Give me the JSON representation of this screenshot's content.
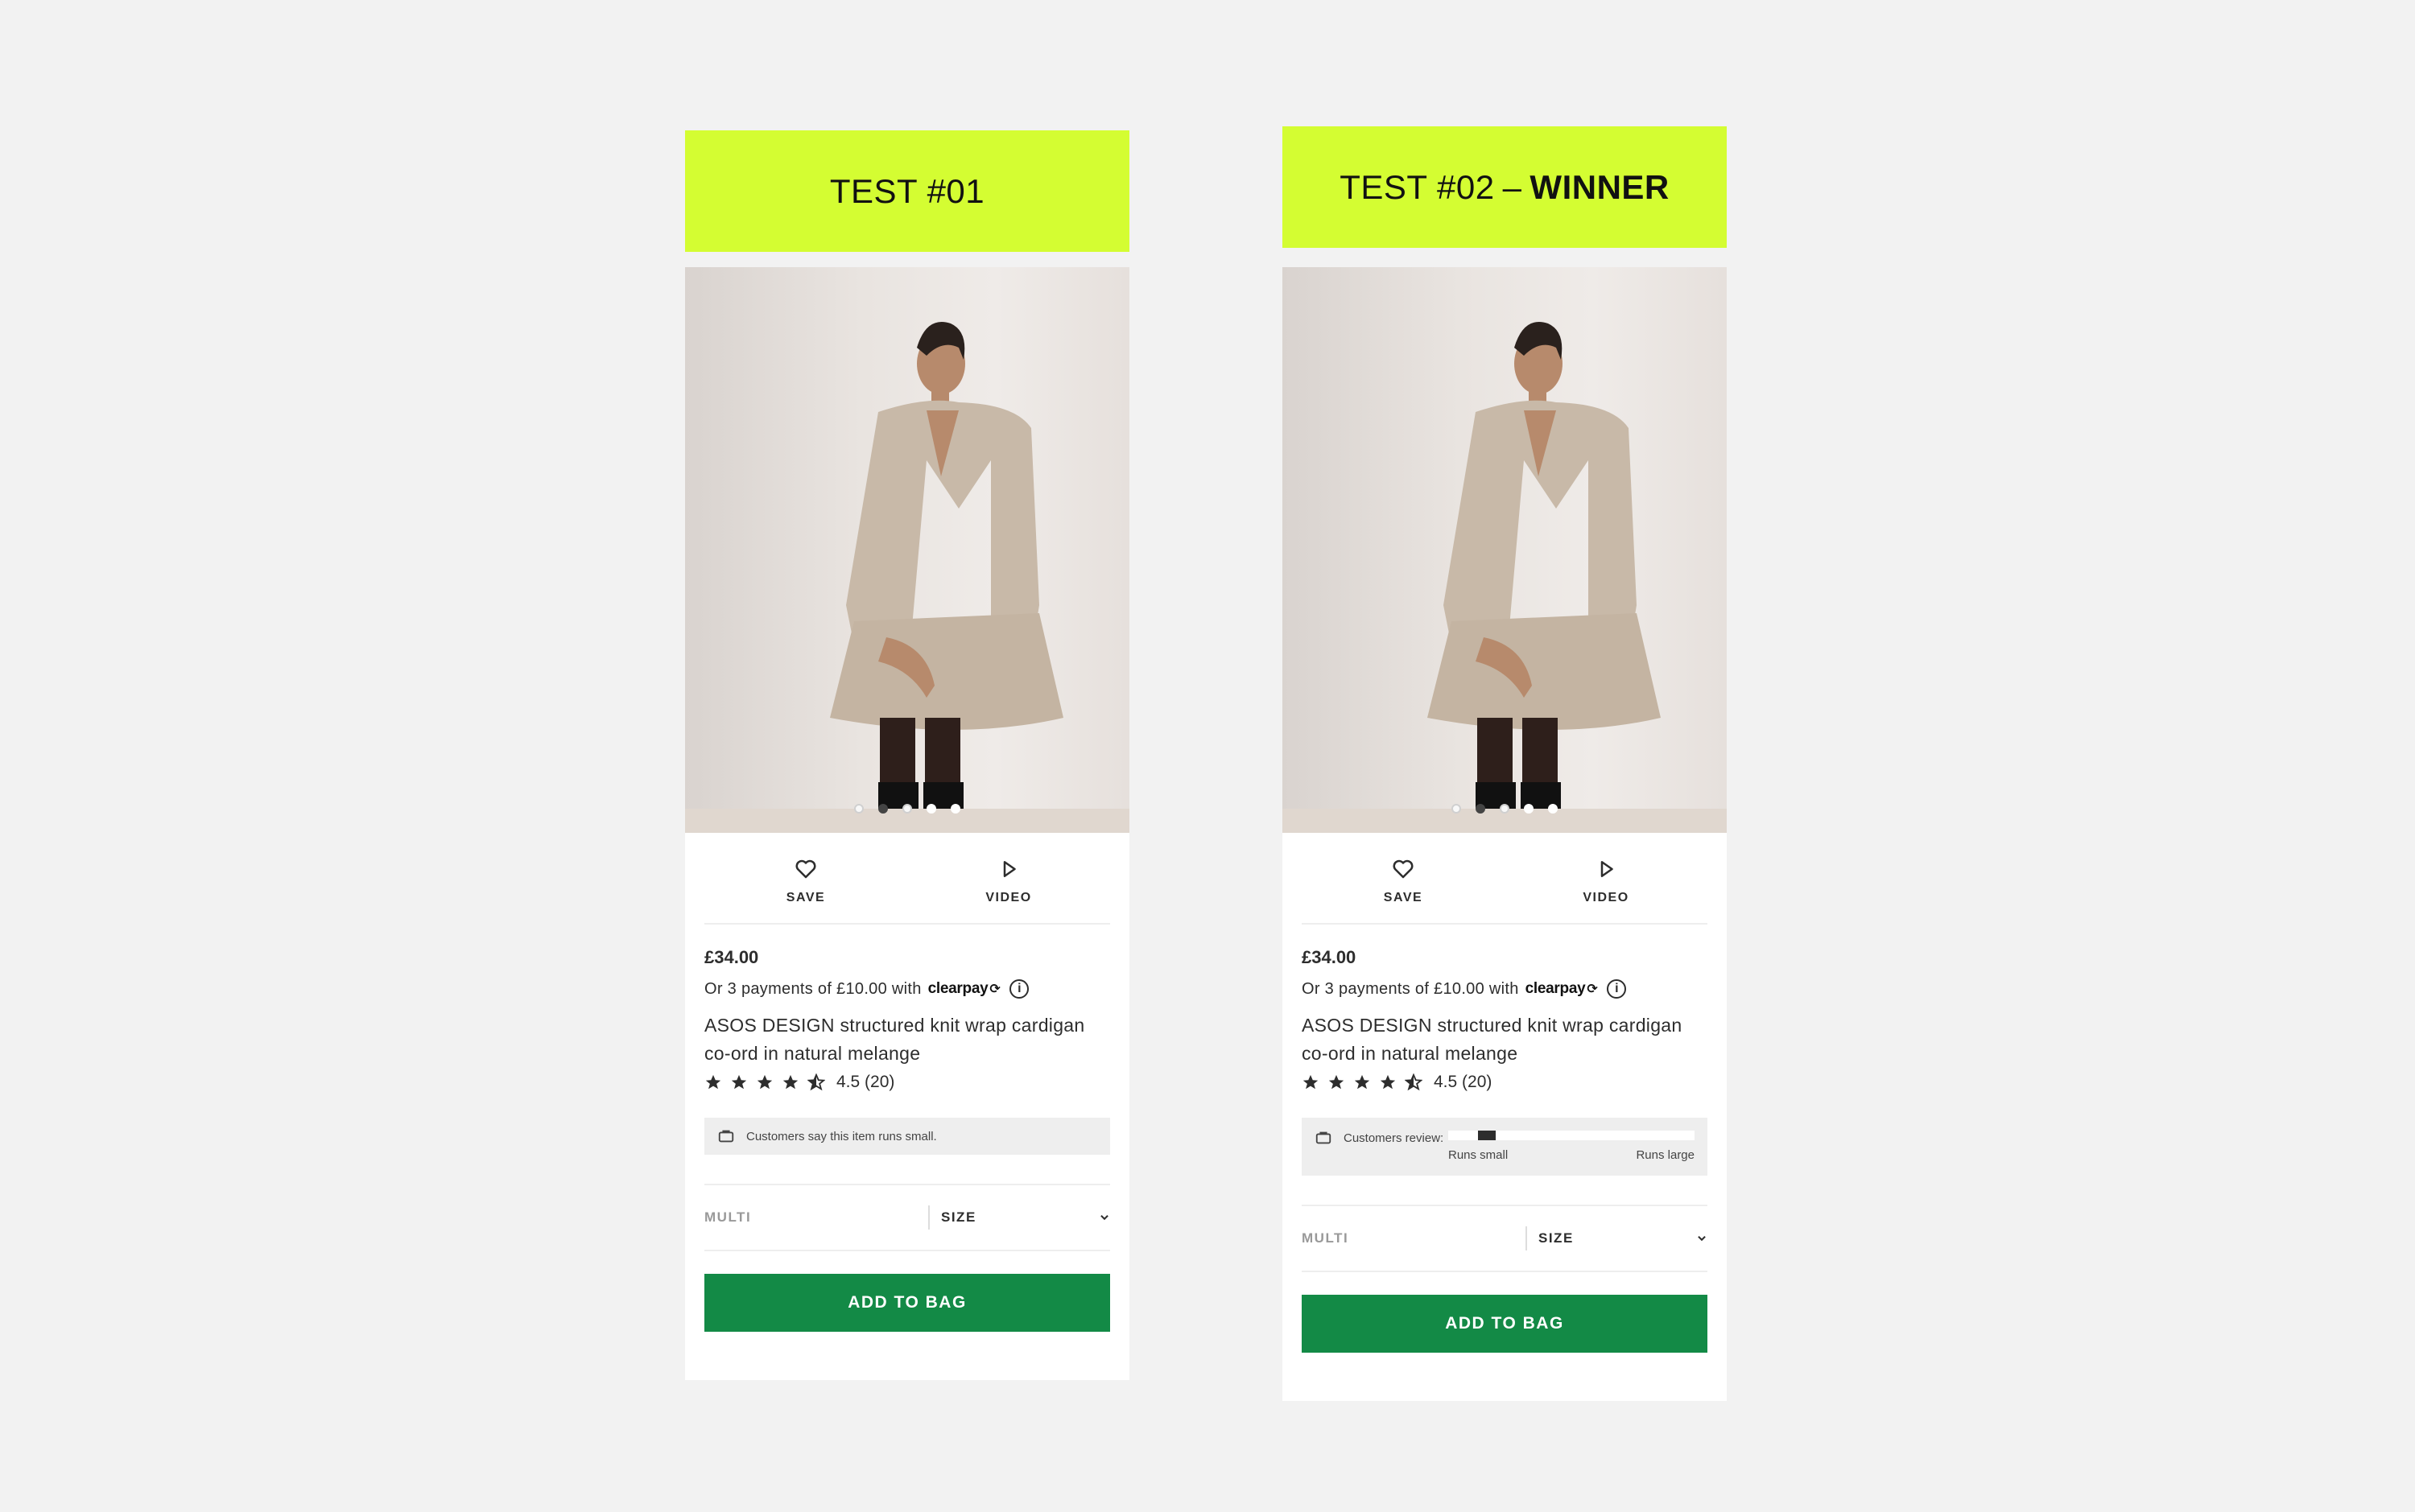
{
  "tests": [
    {
      "header_text": "TEST #01",
      "header_sep": "",
      "header_bold": "",
      "actions": {
        "save": "SAVE",
        "video": "VIDEO"
      },
      "price": "£34.00",
      "installments": "Or 3 payments of £10.00 with",
      "payment_brand": "clearpay",
      "product_title": "ASOS DESIGN structured knit wrap cardigan co-ord in natural melange",
      "rating": {
        "value": 4.5,
        "text": "4.5 (20)"
      },
      "fit_note": "Customers say this item runs small.",
      "colour": "MULTI",
      "size_label": "SIZE",
      "add_button": "ADD TO BAG"
    },
    {
      "header_text": "TEST #02",
      "header_sep": "–",
      "header_bold": "WINNER",
      "actions": {
        "save": "SAVE",
        "video": "VIDEO"
      },
      "price": "£34.00",
      "installments": "Or 3 payments of £10.00 with",
      "payment_brand": "clearpay",
      "product_title": "ASOS DESIGN structured knit wrap cardigan co-ord in natural melange",
      "rating": {
        "value": 4.5,
        "text": "4.5 (20)"
      },
      "fit_review": {
        "label": "Customers review:",
        "left": "Runs small",
        "right": "Runs large",
        "position": 0.12
      },
      "colour": "MULTI",
      "size_label": "SIZE",
      "add_button": "ADD TO BAG"
    }
  ],
  "gallery": {
    "count": 5,
    "active": 1
  },
  "colors": {
    "header_bg": "#d4fd32",
    "add_button_bg": "#138a46",
    "page_bg": "#f2f2f2"
  },
  "icons": [
    "heart-icon",
    "play-icon",
    "info-icon",
    "star-icon",
    "half-star-icon",
    "hanger-icon",
    "chevron-down-icon"
  ]
}
